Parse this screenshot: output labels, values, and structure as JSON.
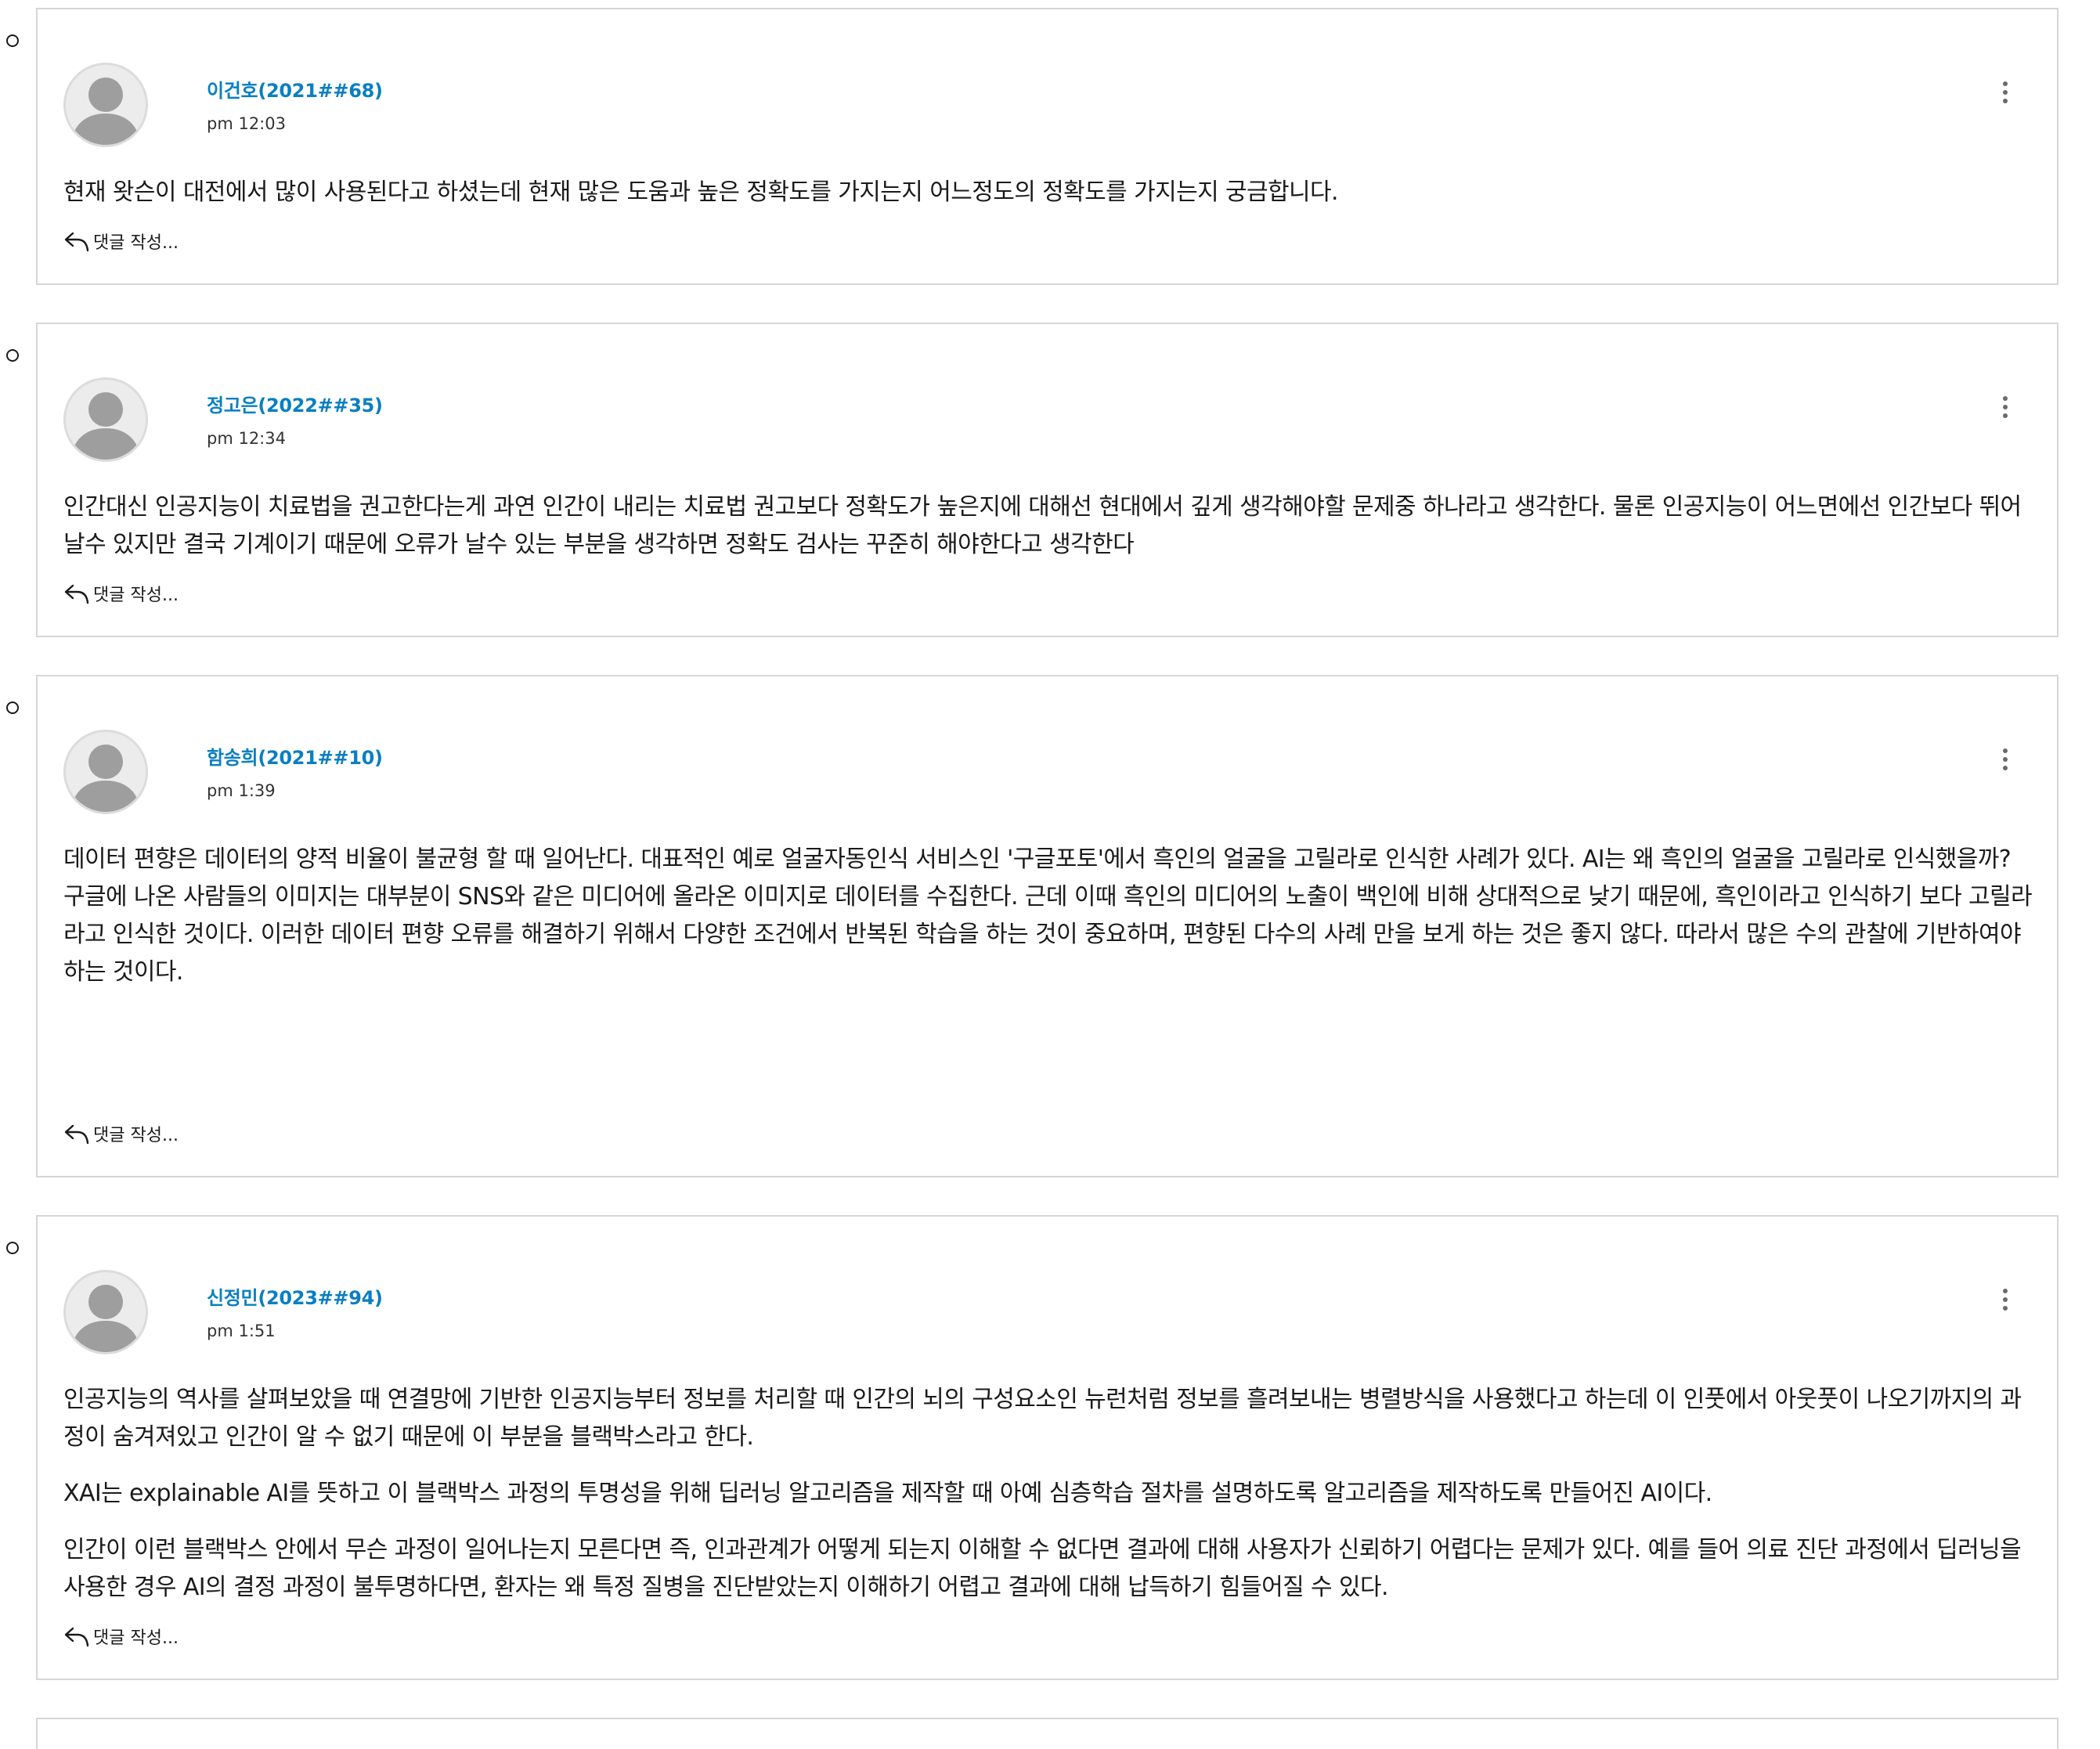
{
  "comments": [
    {
      "author": "이건호(2021##68)",
      "time": "pm 12:03",
      "paragraphs": [
        "현재 왓슨이 대전에서 많이 사용된다고 하셨는데 현재 많은 도움과 높은 정확도를 가지는지 어느정도의 정확도를 가지는지 궁금합니다."
      ],
      "reply_label": "댓글 작성..."
    },
    {
      "author": "정고은(2022##35)",
      "time": "pm 12:34",
      "paragraphs": [
        "인간대신 인공지능이 치료법을 권고한다는게 과연 인간이 내리는 치료법 권고보다 정확도가 높은지에 대해선 현대에서 깊게 생각해야할 문제중 하나라고 생각한다. 물론 인공지능이 어느면에선 인간보다 뛰어날수 있지만 결국 기계이기 때문에 오류가 날수 있는 부분을 생각하면 정확도 검사는 꾸준히 해야한다고 생각한다"
      ],
      "reply_label": "댓글 작성..."
    },
    {
      "author": "함송희(2021##10)",
      "time": "pm 1:39",
      "paragraphs": [
        "데이터 편향은 데이터의 양적 비율이 불균형 할 때 일어난다. 대표적인 예로 얼굴자동인식 서비스인 '구글포토'에서 흑인의 얼굴을 고릴라로 인식한 사례가 있다. AI는 왜 흑인의 얼굴을 고릴라로 인식했을까? 구글에 나온 사람들의 이미지는 대부분이 SNS와 같은 미디어에 올라온 이미지로 데이터를 수집한다. 근데 이때 흑인의 미디어의 노출이 백인에 비해 상대적으로 낮기 때문에, 흑인이라고 인식하기 보다 고릴라라고 인식한 것이다. 이러한 데이터 편향 오류를 해결하기 위해서 다양한 조건에서 반복된 학습을 하는 것이 중요하며, 편향된 다수의 사례 만을 보게 하는 것은 좋지 않다. 따라서 많은 수의 관찰에 기반하여야 하는 것이다."
      ],
      "reply_label": "댓글 작성..."
    },
    {
      "author": "신정민(2023##94)",
      "time": "pm 1:51",
      "paragraphs": [
        "인공지능의 역사를 살펴보았을 때 연결망에 기반한 인공지능부터 정보를 처리할 때 인간의 뇌의 구성요소인 뉴런처럼 정보를 흘려보내는 병렬방식을 사용했다고 하는데 이 인풋에서 아웃풋이 나오기까지의 과정이 숨겨져있고 인간이 알 수 없기 때문에 이 부분을 블랙박스라고 한다.",
        "XAI는 explainable AI를 뜻하고 이 블랙박스 과정의 투명성을 위해 딥러닝 알고리즘을 제작할 때 아예 심층학습 절차를 설명하도록 알고리즘을 제작하도록 만들어진 AI이다.",
        "인간이 이런 블랙박스 안에서 무슨 과정이 일어나는지 모른다면 즉, 인과관계가 어떻게 되는지 이해할 수 없다면 결과에 대해 사용자가 신뢰하기 어렵다는 문제가 있다. 예를 들어 의료 진단 과정에서 딥러닝을 사용한 경우 AI의 결정 과정이 불투명하다면, 환자는 왜 특정 질병을 진단받았는지 이해하기 어렵고 결과에 대해 납득하기 힘들어질 수 있다."
      ],
      "reply_label": "댓글 작성..."
    }
  ],
  "icons": {
    "avatar": "default-user-silhouette",
    "menu": "vertical-ellipsis-icon",
    "reply": "reply-arrow-icon"
  }
}
